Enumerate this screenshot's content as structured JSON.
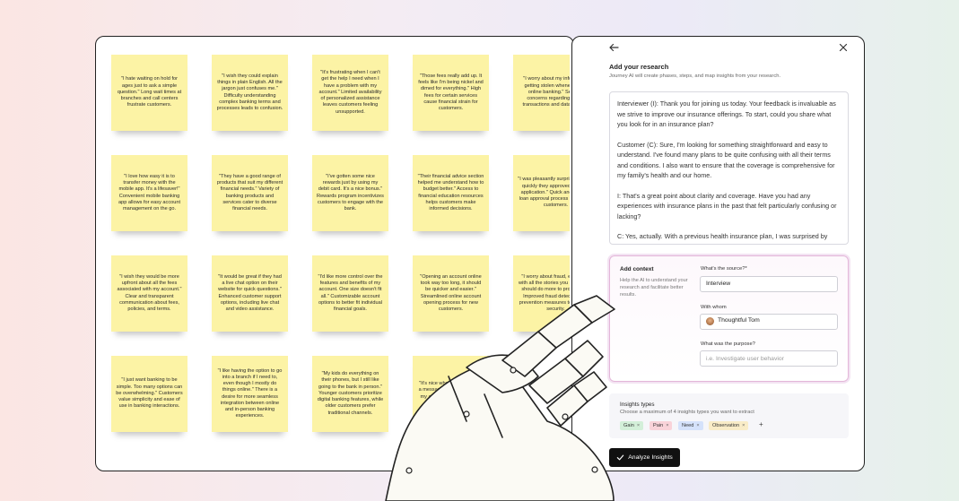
{
  "board": {
    "notes": [
      {
        "text": "\"I hate waiting on hold for ages just to ask a simple question.\" Long wait times at branches and call centers frustrate customers."
      },
      {
        "text": "\"I wish they could explain things in plain English. All the jargon just confuses me.\" Difficulty understanding complex banking terms and processes leads to confusion."
      },
      {
        "text": "\"It's frustrating when I can't get the help I need when I have a problem with my account.\" Limited availability of personalized assistance leaves customers feeling unsupported."
      },
      {
        "text": "\"Those fees really add up. It feels like I'm being nickel and dimed for everything.\" High fees for certain services cause financial strain for customers."
      },
      {
        "text": "\"I worry about my information getting stolen whenever I do online banking.\" Security concerns regarding online transactions and data privacy."
      },
      {
        "text": "\"I love how easy it is to transfer money with the mobile app. It's a lifesaver!\" Convenient mobile banking app allows for easy account management on the go."
      },
      {
        "text": "\"They have a good range of products that suit my different financial needs.\" Variety of banking products and services cater to diverse financial needs."
      },
      {
        "text": "\"I've gotten some nice rewards just by using my debit card. It's a nice bonus.\" Rewards program incentivizes customers to engage with the bank."
      },
      {
        "text": "\"Their financial advice section helped me understand how to budget better.\" Access to financial education resources helps customers make informed decisions."
      },
      {
        "text": "\"I was pleasantly surprised at how quickly they approved my loan application.\" Quick and efficient loan approval process for eligible customers."
      },
      {
        "text": "\"I wish they would be more upfront about all the fees associated with my account.\" Clear and transparent communication about fees, policies, and terms."
      },
      {
        "text": "\"It would be great if they had a live chat option on their website for quick questions.\" Enhanced customer support options, including live chat and video assistance."
      },
      {
        "text": "\"I'd like more control over the features and benefits of my account. One size doesn't fit all.\" Customizable account options to better fit individual financial goals."
      },
      {
        "text": "\"Opening an account online took way too long, it should be quicker and easier.\" Streamlined online account opening process for new customers."
      },
      {
        "text": "\"I worry about fraud, especially with all the stories you hear. They should do more to protect me.\" Improved fraud detection and prevention measures to enhance security."
      },
      {
        "text": "\"I just want banking to be simple. Too many options can be overwhelming.\" Customers value simplicity and ease of use in banking interactions."
      },
      {
        "text": "\"I like having the option to go into a branch if I need to, even though I mostly do things online.\" There is a desire for more seamless integration between online and in-person banking experiences."
      },
      {
        "text": "\"My kids do everything on their phones, but I still like going to the bank in person.\" Younger customers prioritize digital banking features, while older customers prefer traditional channels."
      },
      {
        "text": "\"It's nice when they send me a message about changes to my account. Makes me feel taken care of.\""
      }
    ]
  },
  "panel": {
    "title": "Add your research",
    "subtitle": "Journey AI will create phases, steps, and map insights from your research.",
    "transcript": [
      "Interviewer (I): Thank you for joining us today. Your feedback is invaluable as we strive to improve our insurance offerings. To start, could you share what you look for in an insurance plan?",
      "Customer (C): Sure, I'm looking for something straightforward and easy to understand. I've found many plans to be quite confusing with all their terms and conditions. I also want to ensure that the coverage is comprehensive for my family's health and our home.",
      "I: That's a great point about clarity and coverage. Have you had any experiences with insurance plans in the past that felt particularly confusing or lacking?",
      "C: Yes, actually. With a previous health insurance plan, I was surprised by some hidden costs that weren't clearly explained upfront. It made me feel a bit distrustful of insurance products in general."
    ],
    "context": {
      "title": "Add context",
      "description": "Help the AI to understand your research and facilitate better results.",
      "source_label": "What's the source?*",
      "source_value": "Interview",
      "with_whom_label": "With whom",
      "with_whom_value": "Thoughtful Tom",
      "purpose_label": "What was the purpose?",
      "purpose_placeholder": "i.e. Investigate user behavior"
    },
    "insights": {
      "title": "Insights types",
      "subtitle": "Choose a maximum of 4 insights types you want to extract",
      "chips": [
        {
          "label": "Gain",
          "color": "#d3efd9"
        },
        {
          "label": "Pain",
          "color": "#f9d3d9"
        },
        {
          "label": "Need",
          "color": "#d5e2fb"
        },
        {
          "label": "Observation",
          "color": "#f9ecc7"
        }
      ],
      "remove_glyph": "×",
      "add_glyph": "+"
    },
    "analyze_label": "Analyze Insights"
  }
}
